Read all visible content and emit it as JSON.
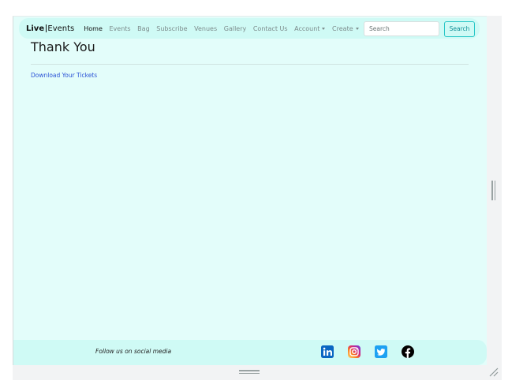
{
  "navbar": {
    "brand_strong": "Live",
    "brand_rest": "Events",
    "links": [
      {
        "label": "Home",
        "active": true
      },
      {
        "label": "Events"
      },
      {
        "label": "Bag"
      },
      {
        "label": "Subscribe"
      },
      {
        "label": "Venues"
      },
      {
        "label": "Gallery"
      },
      {
        "label": "Contact Us"
      },
      {
        "label": "Account",
        "dropdown": true
      },
      {
        "label": "Create",
        "dropdown": true
      }
    ],
    "search_placeholder": "Search",
    "search_button": "Search"
  },
  "main": {
    "title": "Thank You",
    "download_link": "Download Your Tickets"
  },
  "footer": {
    "text": "Follow us on social media",
    "social_icons": [
      "linkedin-icon",
      "instagram-icon",
      "twitter-icon",
      "facebook-icon"
    ]
  },
  "colors": {
    "page_bg": "#e3fdfa",
    "bar_bg": "#cffaf5",
    "accent": "#25c6c6",
    "link": "#2a52d6"
  }
}
